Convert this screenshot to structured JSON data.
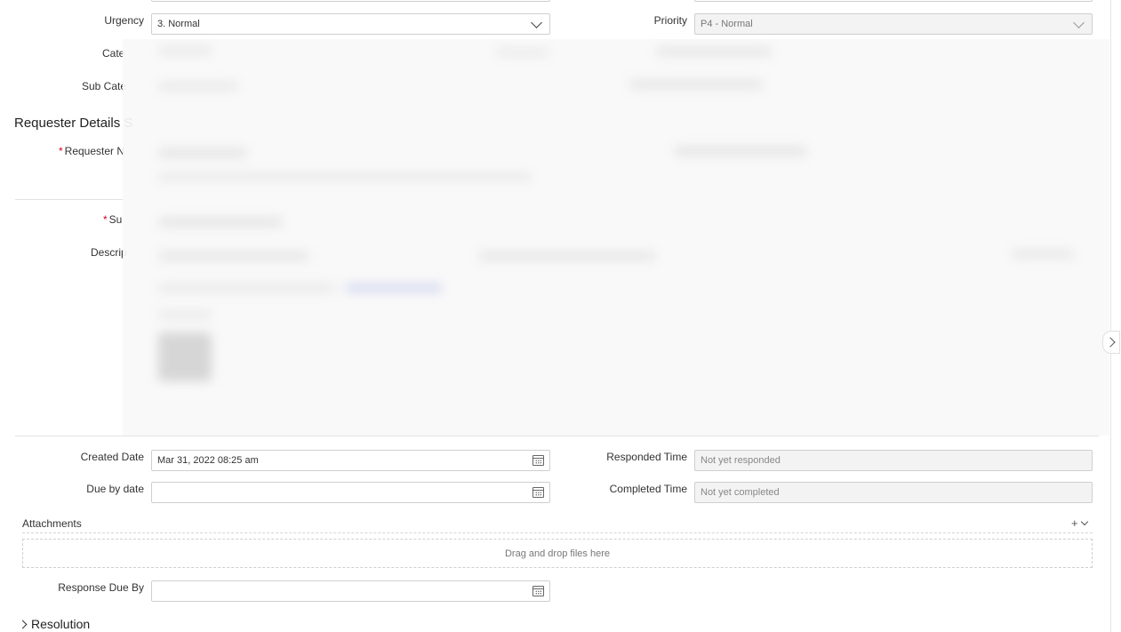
{
  "fields": {
    "urgency": {
      "label": "Urgency",
      "value": "3. Normal"
    },
    "priority": {
      "label": "Priority",
      "value": "P4 - Normal"
    },
    "category": {
      "label": "Cate"
    },
    "sub_category": {
      "label": "Sub Cate"
    },
    "requester_name": {
      "label": "Requester N"
    },
    "subject": {
      "label": "Su"
    },
    "description": {
      "label": "Descrip"
    },
    "created_date": {
      "label": "Created Date",
      "value": "Mar 31, 2022 08:25 am"
    },
    "responded_time": {
      "label": "Responded Time",
      "value": "Not yet responded"
    },
    "due_by_date": {
      "label": "Due by date",
      "value": ""
    },
    "completed_time": {
      "label": "Completed Time",
      "value": "Not yet completed"
    },
    "response_due_by": {
      "label": "Response Due By",
      "value": ""
    }
  },
  "sections": {
    "requester_details": "Requester Details S",
    "resolution": "Resolution"
  },
  "attachments": {
    "label": "Attachments",
    "add_symbol": "+",
    "dropzone_text": "Drag and drop files here"
  },
  "icons": {
    "urgency_dropdown": "chevron-down-icon",
    "priority_dropdown": "chevron-down-icon",
    "calendar": "calendar-icon",
    "expand_resolution": "chevron-right-icon",
    "side_panel_toggle": "chevron-right-icon"
  },
  "colors": {
    "required_marker": "#d0021b",
    "disabled_field_bg": "#f3f3f3"
  }
}
